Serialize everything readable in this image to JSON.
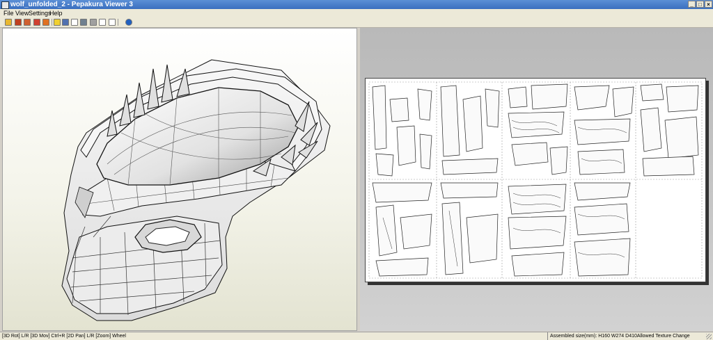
{
  "window": {
    "title": "wolf_unfolded_2 - Pepakura Viewer 3",
    "minimize_glyph": "_",
    "maximize_glyph": "□",
    "close_glyph": "×"
  },
  "menu": {
    "items": [
      "File",
      "View",
      "Settings",
      "Help"
    ]
  },
  "toolbar": {
    "buttons": [
      {
        "icon": "open-folder-icon",
        "color": "#e8b830"
      },
      {
        "icon": "3d-view-icon",
        "color": "#c04020"
      },
      {
        "icon": "print-icon",
        "color": "#d06030"
      },
      {
        "icon": "texture-icon",
        "color": "#d04030"
      },
      {
        "icon": "model-icon",
        "color": "#e07020"
      },
      {
        "icon": "lightbulb-icon",
        "color": "#f0d030"
      },
      {
        "icon": "layout-icon",
        "color": "#5070b0"
      },
      {
        "icon": "page-icon",
        "color": "#ffffff"
      },
      {
        "icon": "wrench-icon",
        "color": "#708090"
      },
      {
        "icon": "edge-icon",
        "color": "#a0a0a0"
      },
      {
        "icon": "window-icon",
        "color": "#ffffff"
      },
      {
        "icon": "window2-icon",
        "color": "#ffffff"
      },
      {
        "icon": "info-icon",
        "color": "#2060c0"
      }
    ]
  },
  "status": {
    "left": "[3D Rot] L/R [3D Mov] Ctrl+R [2D Pan] L/R [Zoom] Wheel",
    "right": "Assembled size(mm): H160 W274 D410Allowed Texture Change"
  },
  "colors": {
    "title_bar": "#3a6fbf",
    "chrome": "#ece9d8",
    "view2d_bg": "#c4c4c4",
    "paper": "#ffffff"
  }
}
